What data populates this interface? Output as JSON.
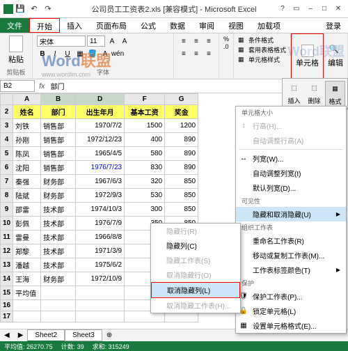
{
  "titlebar": {
    "title": "公司员工工资表2.xls  [兼容模式] - Microsoft Excel"
  },
  "tabs": {
    "file": "文件",
    "home": "开始",
    "insert": "插入",
    "layout": "页面布局",
    "formulas": "公式",
    "data": "数据",
    "review": "审阅",
    "view": "视图",
    "addins": "加载项",
    "login": "登录"
  },
  "ribbon": {
    "clipboard": "剪贴板",
    "paste": "粘贴",
    "font": "字体",
    "font_name": "宋体",
    "font_size": "11",
    "format": {
      "cond": "条件格式",
      "table": "套用表格格式",
      "cell": "单元格样式"
    },
    "cells": "单元格",
    "editing": "编辑"
  },
  "watermark": {
    "word": "Word",
    "alliance": "联盟",
    "url": "www.wordlm.com"
  },
  "name_box": "B2",
  "formula": "部门",
  "cells_menu": {
    "insert": "插入",
    "delete": "删除",
    "format": "格式"
  },
  "cols": {
    "A": "A",
    "B": "B",
    "D": "D",
    "F": "F",
    "G": "G"
  },
  "headers": {
    "name": "姓名",
    "dept": "部门",
    "birth": "出生年月",
    "base": "基本工资",
    "bonus": "奖金"
  },
  "rows": [
    {
      "n": "3",
      "name": "刘铁",
      "dept": "销售部",
      "birth": "1970/7/2",
      "base": "1500",
      "bonus": "1200"
    },
    {
      "n": "4",
      "name": "孙刚",
      "dept": "销售部",
      "birth": "1972/12/23",
      "base": "400",
      "bonus": "890"
    },
    {
      "n": "5",
      "name": "陈凤",
      "dept": "销售部",
      "birth": "1965/4/5",
      "base": "580",
      "bonus": "890"
    },
    {
      "n": "6",
      "name": "沈阳",
      "dept": "销售部",
      "birth": "1976/7/23",
      "base": "830",
      "bonus": "890"
    },
    {
      "n": "7",
      "name": "秦强",
      "dept": "财务部",
      "birth": "1967/6/3",
      "base": "320",
      "bonus": "850"
    },
    {
      "n": "8",
      "name": "陆斌",
      "dept": "财务部",
      "birth": "1972/9/3",
      "base": "530",
      "bonus": "850"
    },
    {
      "n": "9",
      "name": "邵雷",
      "dept": "技术部",
      "birth": "1974/10/3",
      "base": "300",
      "bonus": "850"
    },
    {
      "n": "10",
      "name": "彭佩",
      "dept": "技术部",
      "birth": "1976/7/9",
      "base": "350",
      "bonus": "850"
    },
    {
      "n": "11",
      "name": "雷曼",
      "dept": "技术部",
      "birth": "1966/8/8",
      "base": "",
      "bonus": ""
    },
    {
      "n": "12",
      "name": "郑黎",
      "dept": "技术部",
      "birth": "1971/3/9",
      "base": "",
      "bonus": ""
    },
    {
      "n": "13",
      "name": "潘越",
      "dept": "技术部",
      "birth": "1975/6/2",
      "base": "",
      "bonus": ""
    },
    {
      "n": "14",
      "name": "王海",
      "dept": "财务部",
      "birth": "1972/10/9",
      "base": "",
      "bonus": ""
    },
    {
      "n": "15",
      "name": "平均值",
      "dept": "",
      "birth": "",
      "base": "",
      "bonus": ""
    }
  ],
  "context": {
    "sec1": "单元格大小",
    "row_h": "行高(H)...",
    "auto_row": "自动调整行高(A)",
    "col_w": "列宽(W)...",
    "auto_col": "自动调整列宽(I)",
    "def_w": "默认列宽(D)...",
    "sec2": "可见性",
    "hide": "隐藏和取消隐藏(U)",
    "sec3": "组织工作表",
    "rename": "重命名工作表(R)",
    "move": "移动或复制工作表(M)...",
    "tab_color": "工作表标签颜色(T)",
    "sec4": "保护",
    "protect": "保护工作表(P)...",
    "lock": "锁定单元格(L)",
    "fmt": "设置单元格格式(E)..."
  },
  "submenu": {
    "hide_r": "隐藏行(R)",
    "hide_c": "隐藏列(C)",
    "hide_s": "隐藏工作表(S)",
    "unhide_r": "取消隐藏行(O)",
    "unhide_c": "取消隐藏列(L)",
    "unhide_s": "取消隐藏工作表(H)..."
  },
  "sheets": {
    "s2": "Sheet2",
    "s3": "Sheet3"
  },
  "status": {
    "avg_label": "平均值:",
    "avg": "26270.75",
    "count_label": "计数:",
    "count": "39",
    "sum_label": "求和:",
    "sum": "315249"
  }
}
